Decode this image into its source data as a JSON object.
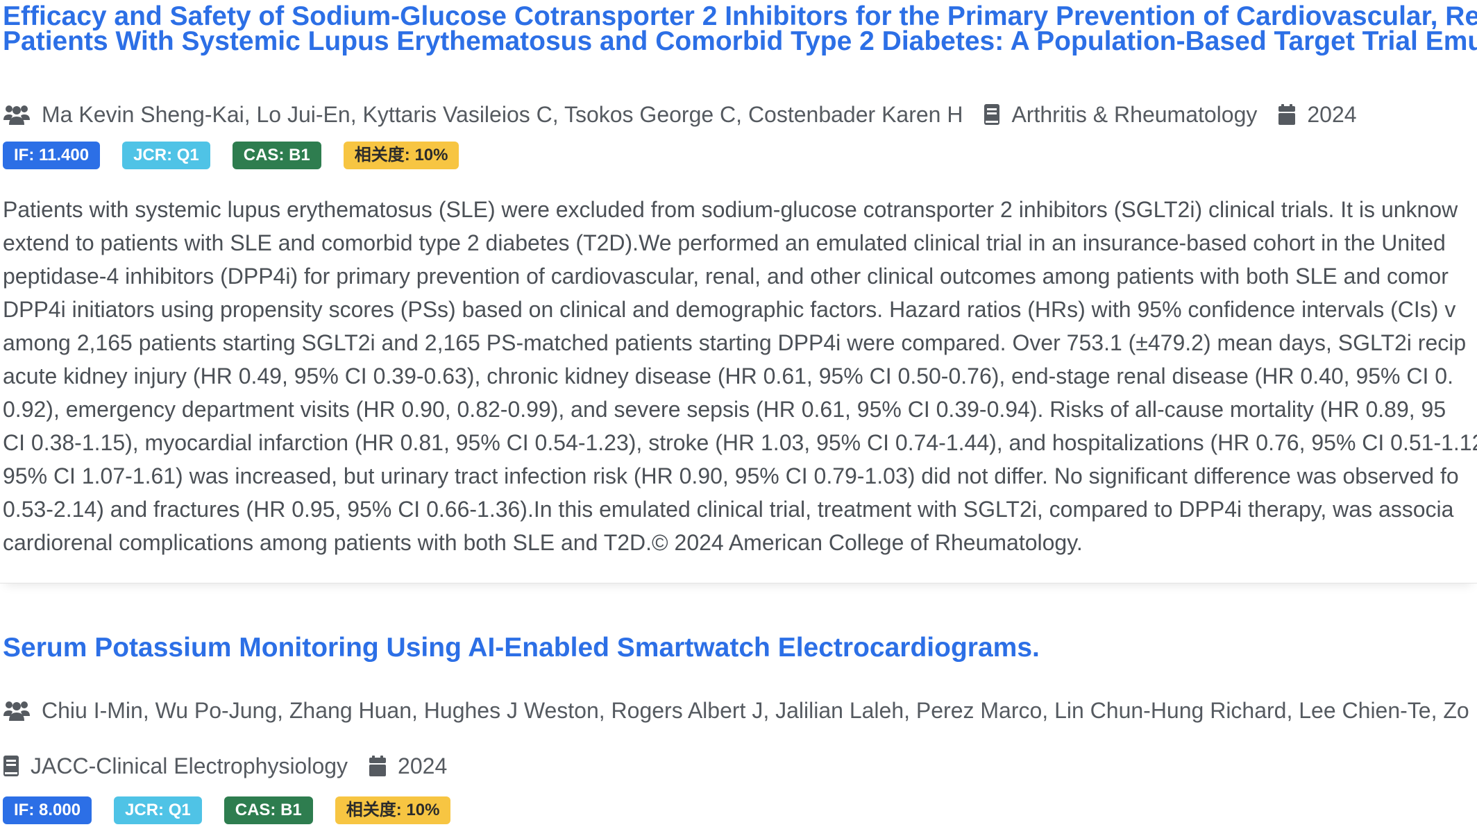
{
  "articles": [
    {
      "title_lines": [
        "Efficacy and Safety of Sodium-Glucose Cotransporter 2 Inhibitors for the Primary Prevention of Cardiovascular, Rena",
        "Patients With Systemic Lupus Erythematosus and Comorbid Type 2 Diabetes: A Population-Based Target Trial Emula"
      ],
      "authors": "Ma Kevin Sheng-Kai, Lo Jui-En, Kyttaris Vasileios C, Tsokos George C, Costenbader Karen H",
      "journal": "Arthritis & Rheumatology",
      "year": "2024",
      "badges": {
        "if": "IF: 11.400",
        "jcr": "JCR: Q1",
        "cas": "CAS: B1",
        "relevance": "相关度: 10%"
      },
      "abstract_lines": [
        "Patients with systemic lupus erythematosus (SLE) were excluded from sodium-glucose cotransporter 2 inhibitors (SGLT2i) clinical trials. It is unknow",
        "extend to patients with SLE and comorbid type 2 diabetes (T2D).We performed an emulated clinical trial in an insurance-based cohort in the United",
        "peptidase-4 inhibitors (DPP4i) for primary prevention of cardiovascular, renal, and other clinical outcomes among patients with both SLE and comor",
        "DPP4i initiators using propensity scores (PSs) based on clinical and demographic factors. Hazard ratios (HRs) with 95% confidence intervals (CIs) v",
        "among 2,165 patients starting SGLT2i and 2,165 PS-matched patients starting DPP4i were compared. Over 753.1 (±479.2) mean days, SGLT2i recip",
        "acute kidney injury (HR 0.49, 95% CI 0.39-0.63), chronic kidney disease (HR 0.61, 95% CI 0.50-0.76), end-stage renal disease (HR 0.40, 95% CI 0.",
        "0.92), emergency department visits (HR 0.90, 0.82-0.99), and severe sepsis (HR 0.61, 95% CI 0.39-0.94). Risks of all-cause mortality (HR 0.89, 95",
        "CI 0.38-1.15), myocardial infarction (HR 0.81, 95% CI 0.54-1.23), stroke (HR 1.03, 95% CI 0.74-1.44), and hospitalizations (HR 0.76, 95% CI 0.51-1.12",
        "95% CI 1.07-1.61) was increased, but urinary tract infection risk (HR 0.90, 95% CI 0.79-1.03) did not differ. No significant difference was observed fo",
        "0.53-2.14) and fractures (HR 0.95, 95% CI 0.66-1.36).In this emulated clinical trial, treatment with SGLT2i, compared to DPP4i therapy, was associa",
        "cardiorenal complications among patients with both SLE and T2D.© 2024 American College of Rheumatology."
      ]
    },
    {
      "title": "Serum Potassium Monitoring Using AI-Enabled Smartwatch Electrocardiograms.",
      "authors": "Chiu I-Min, Wu Po-Jung, Zhang Huan, Hughes J Weston, Rogers Albert J, Jalilian Laleh, Perez Marco, Lin Chun-Hung Richard, Lee Chien-Te, Zo",
      "journal": "JACC-Clinical Electrophysiology",
      "year": "2024",
      "badges": {
        "if": "IF: 8.000",
        "jcr": "JCR: Q1",
        "cas": "CAS: B1",
        "relevance": "相关度: 10%"
      }
    }
  ],
  "icons": {
    "authors": "users-icon",
    "journal": "book-icon",
    "year": "calendar-icon"
  },
  "colors": {
    "title": "#2c6fe6",
    "if_badge": "#2c6fe6",
    "jcr_badge": "#4fc3e6",
    "cas_badge": "#2e7d4f",
    "relevance_badge": "#f7c542",
    "meta_text": "#555a60",
    "abstract_text": "#4b5056"
  }
}
